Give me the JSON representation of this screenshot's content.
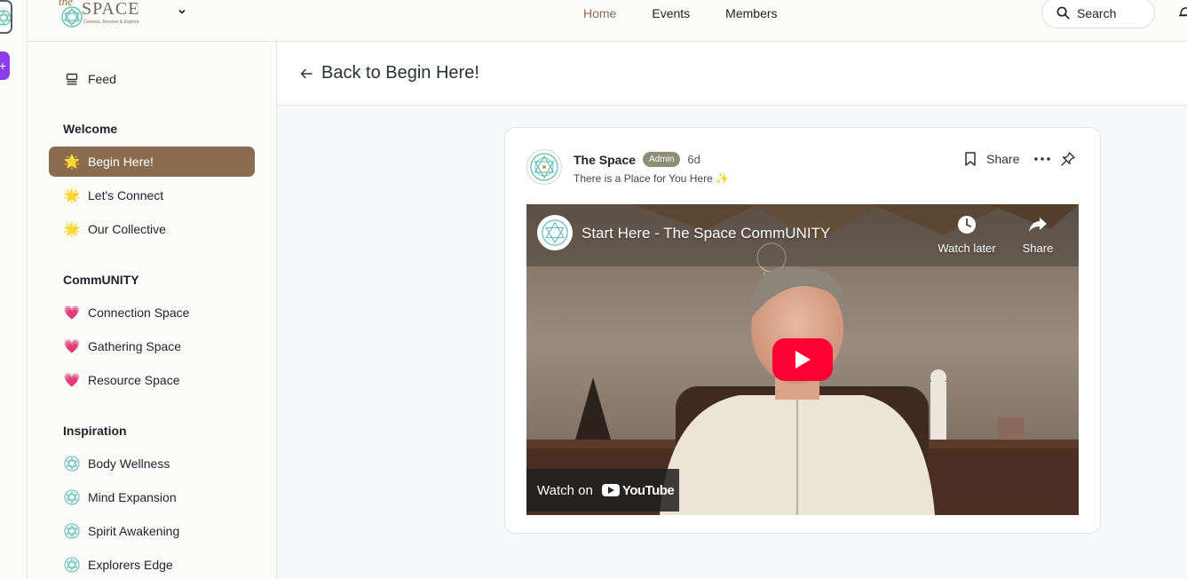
{
  "brand": {
    "script": "the",
    "word": "SPACE",
    "tagline": "Connect, Receive & Explore"
  },
  "nav": {
    "home": "Home",
    "events": "Events",
    "members": "Members"
  },
  "search": {
    "label": "Search"
  },
  "sidebar": {
    "feed": "Feed",
    "sections": [
      {
        "title": "Welcome",
        "items": [
          "Begin Here!",
          "Let's Connect",
          "Our Collective"
        ]
      },
      {
        "title": "CommUNITY",
        "items": [
          "Connection Space",
          "Gathering Space",
          "Resource Space"
        ]
      },
      {
        "title": "Inspiration",
        "items": [
          "Body Wellness",
          "Mind Expansion",
          "Spirit Awakening",
          "Explorers Edge"
        ]
      }
    ],
    "active_item": "Begin Here!"
  },
  "header": {
    "back_label": "Back to Begin Here!"
  },
  "post": {
    "author": "The Space",
    "badge": "Admin",
    "time": "6d",
    "subtitle": "There is a Place for You Here ✨",
    "share_label": "Share"
  },
  "video": {
    "title": "Start Here - The Space CommUNITY",
    "watch_later": "Watch later",
    "share": "Share",
    "watch_on": "Watch on",
    "youtube": "YouTube"
  },
  "colors": {
    "accent": "#8a6b4d",
    "badge": "#8c8f76",
    "play": "#ff0033",
    "rail_add": "#8f3cf0"
  },
  "icons": {
    "welcome_emoji": "🌟",
    "community_emoji": "💗"
  }
}
